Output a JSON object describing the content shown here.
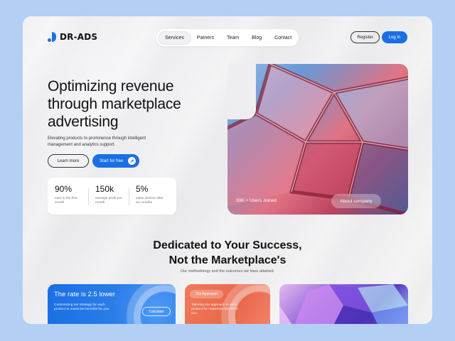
{
  "brand": {
    "name": "DR-ADS",
    "accent": "#1a6fe3"
  },
  "nav": {
    "items": [
      {
        "label": "Services",
        "active": true
      },
      {
        "label": "Patners",
        "active": false
      },
      {
        "label": "Team",
        "active": false
      },
      {
        "label": "Blog",
        "active": false
      },
      {
        "label": "Contact",
        "active": false
      }
    ]
  },
  "auth": {
    "register_label": "Register",
    "login_label": "Log In"
  },
  "hero": {
    "title": "Optimizing revenue through marketplace advertising",
    "subtitle": "Elevating products to prominence through intelligent management and analytics support.",
    "learn_more_label": "Learn more",
    "start_label": "Start for free",
    "stats": [
      {
        "value": "90%",
        "label": "earn in the first month"
      },
      {
        "value": "150k",
        "label": "average profit per month"
      },
      {
        "value": "5%",
        "label": "sales decline after six months"
      }
    ],
    "image_caption": "30K + Users Joined",
    "about_label": "About company"
  },
  "section": {
    "title_line1": "Dedicated to Your Success,",
    "title_line2": "Not the Marketplace's",
    "subtitle": "Our methodology and the outcomes we have attained."
  },
  "cards": {
    "rate": {
      "title": "The rate is 2.5 lower",
      "text": "Customizing our strategy for each product to maximize benefits for you.",
      "button_label": "Calculate"
    },
    "approach": {
      "chip_label": "Our Approach",
      "text": "Tailoring our approach to each product for maximum benefit to you."
    }
  },
  "icons": {
    "logo": "logo-mark-icon",
    "start_arrow": "arrow-up-right-icon"
  }
}
